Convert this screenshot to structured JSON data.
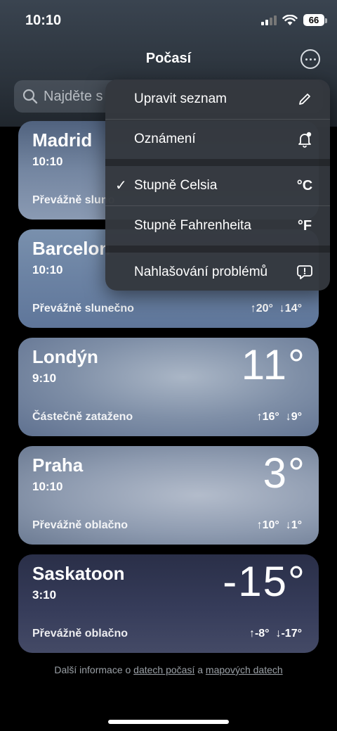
{
  "status": {
    "time": "10:10",
    "battery": "66"
  },
  "header": {
    "title": "Počasí",
    "more_icon": "ellipsis-circle-icon"
  },
  "search": {
    "placeholder": "Najděte s"
  },
  "cards": [
    {
      "city": "Madrid",
      "time": "10:10",
      "condition": "Převážně sluno",
      "temp": "",
      "hi": "",
      "lo": ""
    },
    {
      "city": "Barcelon",
      "time": "10:10",
      "condition": "Převážně slunečno",
      "temp": "",
      "hi": "↑20°",
      "lo": "↓14°"
    },
    {
      "city": "Londýn",
      "time": "9:10",
      "condition": "Částečně zataženo",
      "temp": "11°",
      "hi": "↑16°",
      "lo": "↓9°"
    },
    {
      "city": "Praha",
      "time": "10:10",
      "condition": "Převážně oblačno",
      "temp": "3°",
      "hi": "↑10°",
      "lo": "↓1°"
    },
    {
      "city": "Saskatoon",
      "time": "3:10",
      "condition": "Převážně oblačno",
      "temp": "-15°",
      "hi": "↑-8°",
      "lo": "↓-17°"
    }
  ],
  "menu": {
    "items": [
      {
        "label": "Upravit seznam",
        "icon": "pencil-icon"
      },
      {
        "label": "Oznámení",
        "icon": "bell-badge-icon"
      },
      {
        "label": "Stupně Celsia",
        "icon_text": "°C",
        "checked": "✓"
      },
      {
        "label": "Stupně Fahrenheita",
        "icon_text": "°F"
      },
      {
        "label": "Nahlašování problémů",
        "icon": "report-bubble-icon"
      }
    ]
  },
  "footer": {
    "prefix": "Další informace o ",
    "link1": "datech počasí",
    "middle": " a ",
    "link2": "mapových datech"
  }
}
